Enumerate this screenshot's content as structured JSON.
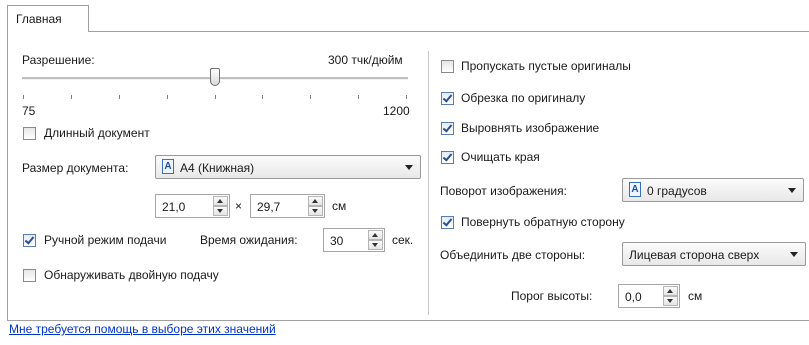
{
  "tab": {
    "label": "Главная"
  },
  "resolution": {
    "label": "Разрешение:",
    "value_text": "300 тчк/дюйм",
    "min_label": "75",
    "max_label": "1200",
    "min": 75,
    "max": 1200,
    "value": 300
  },
  "long_document": {
    "label": "Длинный документ",
    "checked": false
  },
  "document_size": {
    "label": "Размер документа:",
    "selected": "A4 (Книжная)",
    "icon": "portrait-page-icon",
    "width": "21,0",
    "times": "×",
    "height": "29,7",
    "unit": "см"
  },
  "manual_feed": {
    "label": "Ручной режим подачи",
    "checked": true,
    "timeout_label": "Время ожидания:",
    "timeout_value": "30",
    "timeout_unit": "сек."
  },
  "double_feed": {
    "label": "Обнаруживать двойную подачу",
    "checked": false
  },
  "help_link": "Мне требуется помощь в выборе этих значений",
  "skip_blank": {
    "label": "Пропускать пустые оригиналы",
    "checked": false
  },
  "crop_original": {
    "label": "Обрезка по оригиналу",
    "checked": true
  },
  "straighten": {
    "label": "Выровнять изображение",
    "checked": true
  },
  "clean_edges": {
    "label": "Очищать края",
    "checked": true
  },
  "rotate": {
    "label": "Поворот изображения:",
    "selected": "0 градусов",
    "icon": "portrait-page-icon"
  },
  "rotate_back": {
    "label": "Повернуть обратную сторону",
    "checked": true
  },
  "merge_sides": {
    "label": "Объединить две стороны:",
    "selected": "Лицевая сторона сверх"
  },
  "height_threshold": {
    "label": "Порог высоты:",
    "value": "0,0",
    "unit": "см"
  },
  "colors": {
    "link": "#0033cc",
    "check": "#2a4f8c",
    "border": "#a0a0a0"
  }
}
